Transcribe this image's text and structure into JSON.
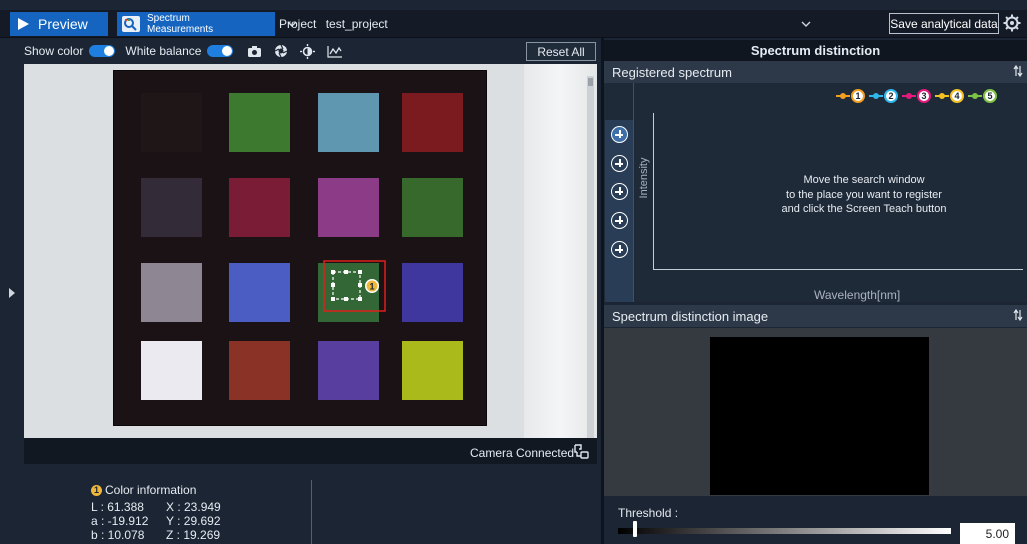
{
  "topbar": {
    "preview_label": "Preview",
    "spectrum_line1": "Spectrum",
    "spectrum_line2": "Measurements",
    "project_label": "Project",
    "project_value": "test_project",
    "save_label": "Save analytical data"
  },
  "toolbar": {
    "show_color_label": "Show color",
    "show_color_on": true,
    "white_balance_label": "White balance",
    "white_balance_on": true,
    "reset_label": "Reset All"
  },
  "chart": {
    "patch_colors": [
      [
        "#1e1617",
        "#3d7a2f",
        "#5f97b0",
        "#7c1b1f"
      ],
      [
        "#332b37",
        "#7a1c35",
        "#8c3b86",
        "#37682c"
      ],
      [
        "#8e8692",
        "#4b5cc2",
        "#336836",
        "#40379e"
      ],
      [
        "#eaeaf0",
        "#8b3227",
        "#583e9f",
        "#a9ba1a"
      ]
    ],
    "search_window_number": "1"
  },
  "status": {
    "camera_label": "Camera Connected"
  },
  "color_info": {
    "title": "Color information",
    "badge": "1",
    "row1_left": "L : 61.388",
    "row1_right": "X : 23.949",
    "row2_left": "a : -19.912",
    "row2_right": "Y : 29.692",
    "row3_left": "b : 10.078",
    "row3_right": "Z : 19.269"
  },
  "right_panel": {
    "header": "Spectrum distinction",
    "registered_title": "Registered spectrum",
    "y_label": "Intensity",
    "x_label": "Wavelength[nm]",
    "message_line1": "Move the search window",
    "message_line2": "to the place you want to register",
    "message_line3": "and click the Screen Teach button",
    "legend": [
      {
        "num": "1",
        "color": "#f0a01e"
      },
      {
        "num": "2",
        "color": "#2fb6ea"
      },
      {
        "num": "3",
        "color": "#e5197d"
      },
      {
        "num": "4",
        "color": "#f3c023"
      },
      {
        "num": "5",
        "color": "#7dc242"
      }
    ],
    "distinction_title": "Spectrum distinction image",
    "threshold_label": "Threshold :",
    "threshold_value": "5.00",
    "threshold_fraction": 0.05
  }
}
